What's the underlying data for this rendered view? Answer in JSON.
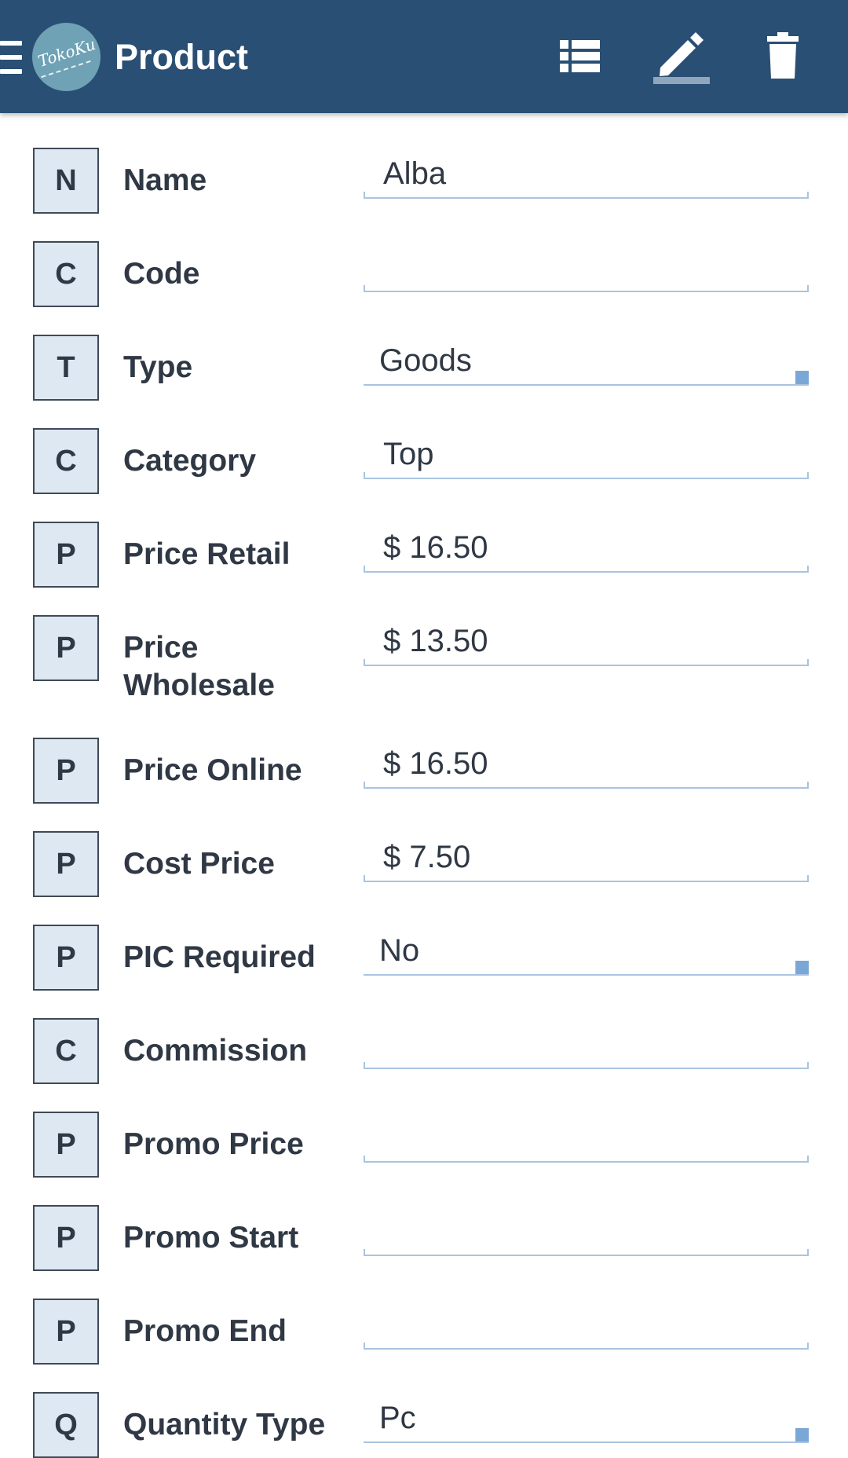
{
  "header": {
    "title": "Product",
    "logo_text": "TokoKu",
    "menu_icon": "hamburger-menu-icon",
    "actions": [
      {
        "name": "list-icon"
      },
      {
        "name": "edit-pencil-icon"
      },
      {
        "name": "trash-delete-icon"
      }
    ],
    "bar_color": "#2a4f74"
  },
  "form": {
    "fields": [
      {
        "badge": "N",
        "label": "Name",
        "value": "Alba",
        "kind": "text"
      },
      {
        "badge": "C",
        "label": "Code",
        "value": "",
        "kind": "text"
      },
      {
        "badge": "T",
        "label": "Type",
        "value": "Goods",
        "kind": "select"
      },
      {
        "badge": "C",
        "label": "Category",
        "value": "Top",
        "kind": "text"
      },
      {
        "badge": "P",
        "label": "Price Retail",
        "value": "$ 16.50",
        "kind": "text"
      },
      {
        "badge": "P",
        "label": "Price Wholesale",
        "value": "$ 13.50",
        "kind": "text"
      },
      {
        "badge": "P",
        "label": "Price Online",
        "value": "$ 16.50",
        "kind": "text"
      },
      {
        "badge": "P",
        "label": "Cost Price",
        "value": "$ 7.50",
        "kind": "text"
      },
      {
        "badge": "P",
        "label": "PIC Required",
        "value": "No",
        "kind": "select"
      },
      {
        "badge": "C",
        "label": "Commission",
        "value": "",
        "kind": "text"
      },
      {
        "badge": "P",
        "label": "Promo Price",
        "value": "",
        "kind": "text"
      },
      {
        "badge": "P",
        "label": "Promo Start",
        "value": "",
        "kind": "text"
      },
      {
        "badge": "P",
        "label": "Promo End",
        "value": "",
        "kind": "text"
      },
      {
        "badge": "Q",
        "label": "Quantity Type",
        "value": "Pc",
        "kind": "select"
      }
    ]
  },
  "colors": {
    "badge_bg": "#dde8f3",
    "underline": "#a9c4e0",
    "select_caret": "#7aa7d6",
    "text": "#2f3844"
  }
}
